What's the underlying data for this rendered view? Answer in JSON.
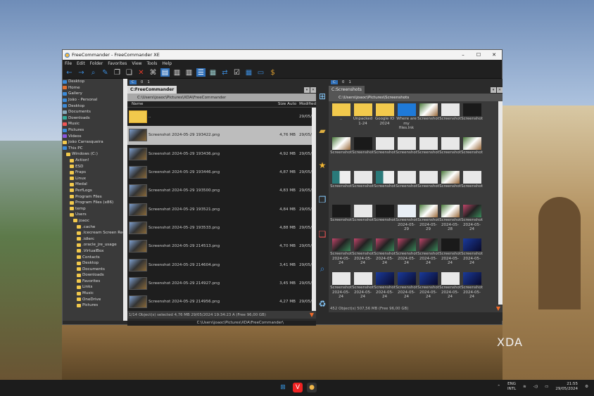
{
  "window": {
    "title": "FreeCommander - FreeCommander XE",
    "minimize": "–",
    "maximize": "☐",
    "close": "✕"
  },
  "menu": [
    "File",
    "Edit",
    "Folder",
    "Favorites",
    "View",
    "Tools",
    "Help"
  ],
  "tree": [
    {
      "label": "Desktop",
      "lvl": 0
    },
    {
      "label": "Home",
      "lvl": 0
    },
    {
      "label": "Gallery",
      "lvl": 0
    },
    {
      "label": "João - Personal",
      "lvl": 0
    },
    {
      "label": "Desktop",
      "lvl": 0
    },
    {
      "label": "Documents",
      "lvl": 0
    },
    {
      "label": "Downloads",
      "lvl": 0
    },
    {
      "label": "Music",
      "lvl": 0
    },
    {
      "label": "Pictures",
      "lvl": 0
    },
    {
      "label": "Videos",
      "lvl": 0
    },
    {
      "label": "João Carrasqueira",
      "lvl": 0
    },
    {
      "label": "This PC",
      "lvl": 0
    },
    {
      "label": "Windows (C:)",
      "lvl": 1
    },
    {
      "label": "Action!",
      "lvl": 2
    },
    {
      "label": "ESD",
      "lvl": 2
    },
    {
      "label": "Fraps",
      "lvl": 2
    },
    {
      "label": "Linux",
      "lvl": 2
    },
    {
      "label": "Medal",
      "lvl": 2
    },
    {
      "label": "PerfLogs",
      "lvl": 2
    },
    {
      "label": "Program Files",
      "lvl": 2
    },
    {
      "label": "Program Files (x86)",
      "lvl": 2
    },
    {
      "label": "temp",
      "lvl": 2
    },
    {
      "label": "Users",
      "lvl": 2
    },
    {
      "label": "joaoc",
      "lvl": 3
    },
    {
      "label": ".cache",
      "lvl": 4
    },
    {
      "label": ".Icecream Screen Reco",
      "lvl": 4
    },
    {
      "label": ".idlerc",
      "lvl": 4
    },
    {
      "label": ".oracle_jre_usage",
      "lvl": 4
    },
    {
      "label": ".VirtualBox",
      "lvl": 4
    },
    {
      "label": "Contacts",
      "lvl": 4
    },
    {
      "label": "Desktop",
      "lvl": 4
    },
    {
      "label": "Documents",
      "lvl": 4
    },
    {
      "label": "Downloads",
      "lvl": 4
    },
    {
      "label": "Favorites",
      "lvl": 4
    },
    {
      "label": "Links",
      "lvl": 4
    },
    {
      "label": "Music",
      "lvl": 4
    },
    {
      "label": "OneDrive",
      "lvl": 4
    },
    {
      "label": "Pictures",
      "lvl": 4
    }
  ],
  "left": {
    "drives": [
      "C",
      "0",
      "1"
    ],
    "tab": "C:FreeCommander",
    "path": "C:\\Users\\joaoc\\Pictures\\XDA\\FreeCommander",
    "columns": {
      "name": "Name",
      "size": "Size Auto",
      "modified": "Modified"
    },
    "parent": {
      "name": "..",
      "modified": "29/05/2024"
    },
    "files": [
      {
        "name": "Screenshot 2024-05-29 193422.png",
        "size": "4,76 MB",
        "modified": "29/05/2024"
      },
      {
        "name": "Screenshot 2024-05-29 193436.png",
        "size": "4,92 MB",
        "modified": "29/05/2024"
      },
      {
        "name": "Screenshot 2024-05-29 193446.png",
        "size": "4,87 MB",
        "modified": "29/05/2024"
      },
      {
        "name": "Screenshot 2024-05-29 193500.png",
        "size": "4,83 MB",
        "modified": "29/05/2024"
      },
      {
        "name": "Screenshot 2024-05-29 193521.png",
        "size": "4,84 MB",
        "modified": "29/05/2024"
      },
      {
        "name": "Screenshot 2024-05-29 193533.png",
        "size": "4,88 MB",
        "modified": "29/05/2024"
      },
      {
        "name": "Screenshot 2024-05-29 214513.png",
        "size": "4,70 MB",
        "modified": "29/05/2024"
      },
      {
        "name": "Screenshot 2024-05-29 214604.png",
        "size": "3,41 MB",
        "modified": "29/05/2024"
      },
      {
        "name": "Screenshot 2024-05-29 214927.png",
        "size": "3,45 MB",
        "modified": "29/05/2024"
      },
      {
        "name": "Screenshot 2024-05-29 214956.png",
        "size": "4,27 MB",
        "modified": "29/05/2024"
      }
    ],
    "status": "1/14 Object(s) selected  4,76 MB  29/05/2024 19:34:23  A  (Free 96,00 GB)",
    "bottom_path": "C:\\Users\\joaoc\\Pictures\\XDA\\FreeCommander\\"
  },
  "right": {
    "drives": [
      "C",
      "0",
      "1"
    ],
    "tab": "C:Screenshots",
    "path": "C:\\Users\\joaoc\\Pictures\\Screenshots",
    "items": [
      {
        "l1": "..",
        "l2": "",
        "k": "up"
      },
      {
        "l1": "Unpacked",
        "l2": "1-24",
        "k": "folder"
      },
      {
        "l1": "Google IO",
        "l2": "2024",
        "k": "folder"
      },
      {
        "l1": "Where are",
        "l2": "my files.lnk",
        "k": "cloud"
      },
      {
        "l1": "Screenshot",
        "l2": "",
        "k": "g"
      },
      {
        "l1": "Screenshot",
        "l2": "",
        "k": "w"
      },
      {
        "l1": "Screenshot",
        "l2": "",
        "k": "d"
      },
      {
        "l1": "Screenshot",
        "l2": "",
        "k": "g"
      },
      {
        "l1": "Screenshot",
        "l2": "",
        "k": "d"
      },
      {
        "l1": "Screenshot",
        "l2": "",
        "k": "w"
      },
      {
        "l1": "Screenshot",
        "l2": "",
        "k": "w"
      },
      {
        "l1": "Screenshot",
        "l2": "",
        "k": "w"
      },
      {
        "l1": "Screenshot",
        "l2": "",
        "k": "w"
      },
      {
        "l1": "Screenshot",
        "l2": "",
        "k": "g"
      },
      {
        "l1": "Screenshot",
        "l2": "",
        "k": "t"
      },
      {
        "l1": "Screenshot",
        "l2": "",
        "k": "w"
      },
      {
        "l1": "Screenshot",
        "l2": "",
        "k": "t"
      },
      {
        "l1": "Screenshot",
        "l2": "",
        "k": "w"
      },
      {
        "l1": "Screenshot",
        "l2": "",
        "k": "w"
      },
      {
        "l1": "Screenshot",
        "l2": "",
        "k": "g"
      },
      {
        "l1": "Screenshot",
        "l2": "",
        "k": "w"
      },
      {
        "l1": "Screenshot",
        "l2": "",
        "k": "d"
      },
      {
        "l1": "Screenshot",
        "l2": "",
        "k": "w"
      },
      {
        "l1": "Screenshot",
        "l2": "",
        "k": "d"
      },
      {
        "l1": "Screenshot",
        "l2": "2024-05-29",
        "k": "file"
      },
      {
        "l1": "Screenshot",
        "l2": "2024-05-29",
        "k": "g"
      },
      {
        "l1": "Screenshot",
        "l2": "2024-05-28",
        "k": "g"
      },
      {
        "l1": "Screenshot",
        "l2": "2024-05-24",
        "k": "c"
      },
      {
        "l1": "Screenshot",
        "l2": "2024-05-24",
        "k": "c"
      },
      {
        "l1": "Screenshot",
        "l2": "2024-05-24",
        "k": "c"
      },
      {
        "l1": "Screenshot",
        "l2": "2024-05-24",
        "k": "c"
      },
      {
        "l1": "Screenshot",
        "l2": "2024-05-24",
        "k": "c"
      },
      {
        "l1": "Screenshot",
        "l2": "2024-05-24",
        "k": "c"
      },
      {
        "l1": "Screenshot",
        "l2": "2024-05-24",
        "k": "d"
      },
      {
        "l1": "Screenshot",
        "l2": "2024-05-24",
        "k": "b"
      },
      {
        "l1": "Screenshot",
        "l2": "2024-05-24",
        "k": "w"
      },
      {
        "l1": "Screenshot",
        "l2": "2024-05-24",
        "k": "w"
      },
      {
        "l1": "Screenshot",
        "l2": "2024-05-24",
        "k": "b"
      },
      {
        "l1": "Screenshot",
        "l2": "2024-05-24",
        "k": "b"
      },
      {
        "l1": "Screenshot",
        "l2": "2024-05-24",
        "k": "b"
      },
      {
        "l1": "Screenshot",
        "l2": "2024-05-24",
        "k": "w"
      },
      {
        "l1": "Screenshot",
        "l2": "2024-05-24",
        "k": "b"
      },
      {
        "l1": "",
        "l2": "",
        "k": "b"
      },
      {
        "l1": "",
        "l2": "",
        "k": "b"
      },
      {
        "l1": "",
        "l2": "",
        "k": "b"
      },
      {
        "l1": "",
        "l2": "",
        "k": "b"
      },
      {
        "l1": "",
        "l2": "",
        "k": "w"
      },
      {
        "l1": "",
        "l2": "",
        "k": "d"
      },
      {
        "l1": "",
        "l2": "",
        "k": "b"
      }
    ],
    "status": "452 Object(s)  507,56 MB  (Free 96,00 GB)"
  },
  "watermark": "XDA",
  "taskbar": {
    "lang1": "ENG",
    "lang2": "INTL",
    "time": "21:55",
    "date": "29/05/2024"
  }
}
